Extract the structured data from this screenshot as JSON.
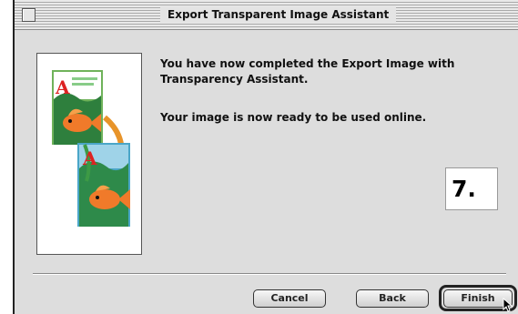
{
  "window": {
    "title": "Export Transparent Image Assistant"
  },
  "content": {
    "message_completed": "You have now completed the Export Image with Transparency Assistant.",
    "message_ready": "Your image is now ready to be used online."
  },
  "overlay": {
    "step_label": "7."
  },
  "buttons": {
    "cancel": "Cancel",
    "back": "Back",
    "finish": "Finish"
  },
  "colors": {
    "window_bg": "#dddddd",
    "panel_bg": "#ffffff",
    "arrow": "#e8942a",
    "fish": "#f07a2a",
    "leaf": "#3d9a45"
  }
}
